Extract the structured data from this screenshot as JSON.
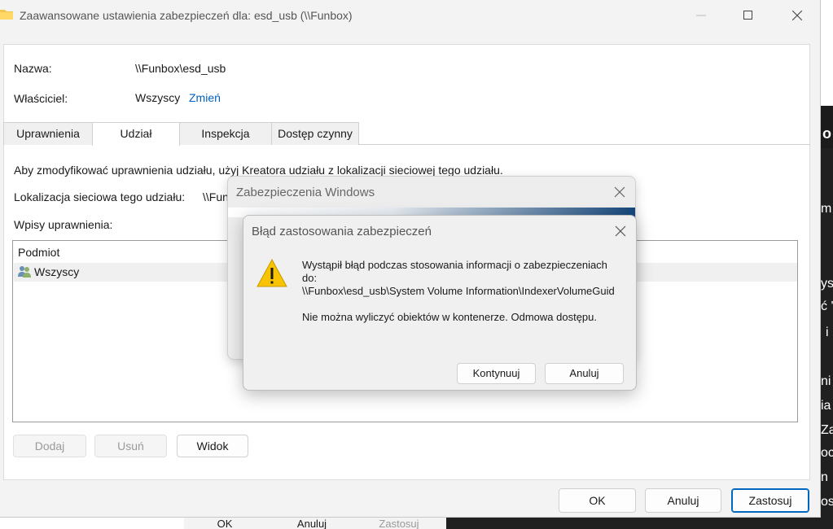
{
  "window": {
    "title": "Zaawansowane ustawienia zabezpieczeń dla: esd_usb (\\\\Funbox)"
  },
  "fields": {
    "name_label": "Nazwa:",
    "name_value": "\\\\Funbox\\esd_usb",
    "owner_label": "Właściciel:",
    "owner_value": "Wszyscy",
    "owner_change_link": "Zmień"
  },
  "tabs": [
    {
      "label": "Uprawnienia"
    },
    {
      "label": "Udział"
    },
    {
      "label": "Inspekcja"
    },
    {
      "label": "Dostęp czynny"
    }
  ],
  "share_tab": {
    "info_text": "Aby zmodyfikować uprawnienia udziału, użyj Kreatora udziału z lokalizacji sieciowej tego udziału.",
    "location_label": "Lokalizacja sieciowa tego udziału:",
    "location_value": "\\\\Fun",
    "entries_label": "Wpisy uprawnienia:",
    "column_header": "Podmiot",
    "entries": [
      {
        "principal": "Wszyscy"
      }
    ],
    "buttons": {
      "add": "Dodaj",
      "remove": "Usuń",
      "view": "Widok"
    }
  },
  "footer_buttons": {
    "ok": "OK",
    "cancel": "Anuluj",
    "apply": "Zastosuj"
  },
  "security_dialog": {
    "title": "Zabezpieczenia Windows"
  },
  "error_dialog": {
    "title": "Błąd zastosowania zabezpieczeń",
    "message_line1": "Wystąpił błąd podczas stosowania informacji o zabezpieczeniach",
    "message_line2": "do:",
    "message_line3": "\\\\Funbox\\esd_usb\\System Volume Information\\IndexerVolumeGuid",
    "message_line4": "Nie można wyliczyć obiektów w kontenerze. Odmowa dostępu.",
    "continue_button": "Kontynuuj",
    "cancel_button": "Anuluj"
  },
  "background": {
    "bottom_buttons": [
      "OK",
      "Anuluj",
      "Zastosuj"
    ],
    "right_fragments": [
      "o",
      "m",
      "ys",
      "ć '",
      "i",
      "ni",
      "ia",
      "Za",
      "oc",
      "n",
      "os"
    ]
  },
  "colors": {
    "link": "#0060c0",
    "primary_border": "#0067c0",
    "warning_yellow": "#f8c300"
  }
}
